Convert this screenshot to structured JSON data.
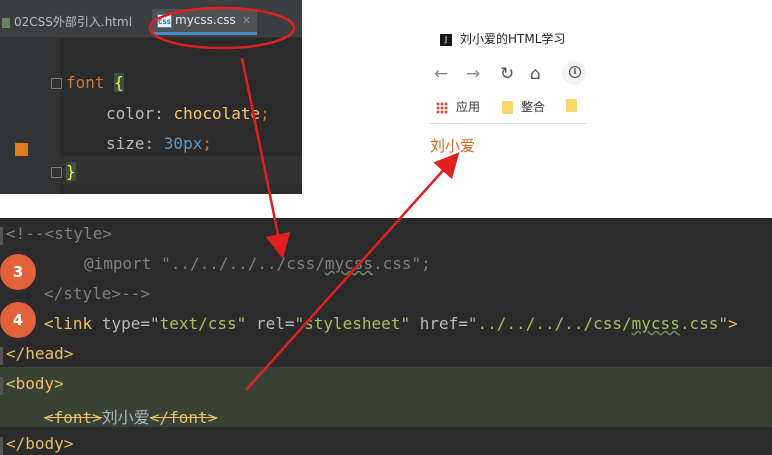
{
  "css_editor": {
    "tabs": [
      {
        "label": "02CSS外部引入.html"
      },
      {
        "label": "mycss.css",
        "icon_text": "CSS"
      }
    ],
    "code": {
      "selector": "font",
      "open_brace": "{",
      "prop1": "color",
      "val1": "chocolate",
      "prop2": "size",
      "val2_num": "30",
      "val2_unit": "px",
      "close_brace": "}"
    },
    "color_swatch": "#d2691e"
  },
  "browser": {
    "tab_title": "刘小爱的HTML学习",
    "bookmarks": [
      "应用",
      "整合"
    ],
    "content_text": "刘小爱"
  },
  "html_editor": {
    "lines": {
      "comment_open": "<!--<style>",
      "import_kw": "@import",
      "import_path_a": "\"../../../../css/",
      "import_path_b": "mycss",
      "import_path_c": ".css\";",
      "comment_close": "</style>-->",
      "link_open": "<link",
      "link_type_attr": "type=",
      "link_type_val": "\"text/css\"",
      "link_rel_attr": "rel=",
      "link_rel_val": "\"stylesheet\"",
      "link_href_attr": "href=",
      "link_href_a": "\"../../../../css/",
      "link_href_b": "mycss",
      "link_href_c": ".css\"",
      "link_close": ">",
      "head_close": "</head>",
      "body_open": "<body>",
      "font_open": "<font>",
      "font_text": "刘小爱",
      "font_close": "</font>",
      "body_close": "</body>"
    },
    "badges": [
      "3",
      "4"
    ]
  },
  "annotation_color": "#e02020"
}
